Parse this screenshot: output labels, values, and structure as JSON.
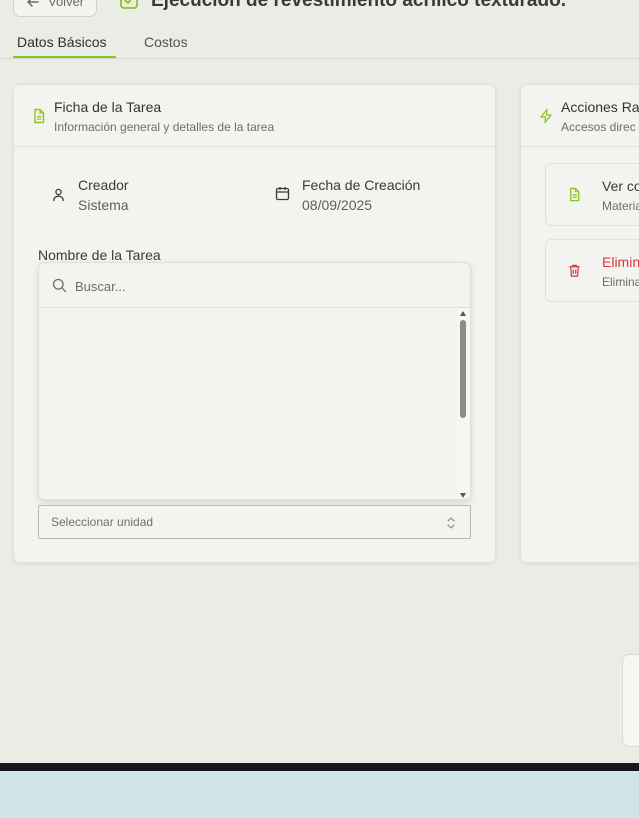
{
  "header": {
    "back_label": "Volver",
    "page_title": "Ejecución de revestimiento acrílico texturado."
  },
  "tabs": [
    {
      "label": "Datos Básicos",
      "active": true
    },
    {
      "label": "Costos",
      "active": false
    }
  ],
  "task_card": {
    "title": "Ficha de la Tarea",
    "subtitle": "Información general y detalles de la tarea",
    "creator_label": "Creador",
    "creator_value": "Sistema",
    "created_label": "Fecha de Creación",
    "created_value": "08/09/2025",
    "name_label": "Nombre de la Tarea",
    "search_placeholder": "Buscar...",
    "unit_placeholder": "Seleccionar unidad"
  },
  "quick_actions": {
    "title": "Acciones Ra",
    "subtitle": "Accesos direc",
    "items": [
      {
        "title": "Ver co",
        "subtitle": "Materia",
        "icon": "document-icon"
      },
      {
        "title": "Elimin",
        "subtitle": "Elimina",
        "icon": "trash-icon"
      }
    ]
  },
  "colors": {
    "accent": "#8fc31f",
    "danger": "#d9363e",
    "background": "#ecece7"
  }
}
